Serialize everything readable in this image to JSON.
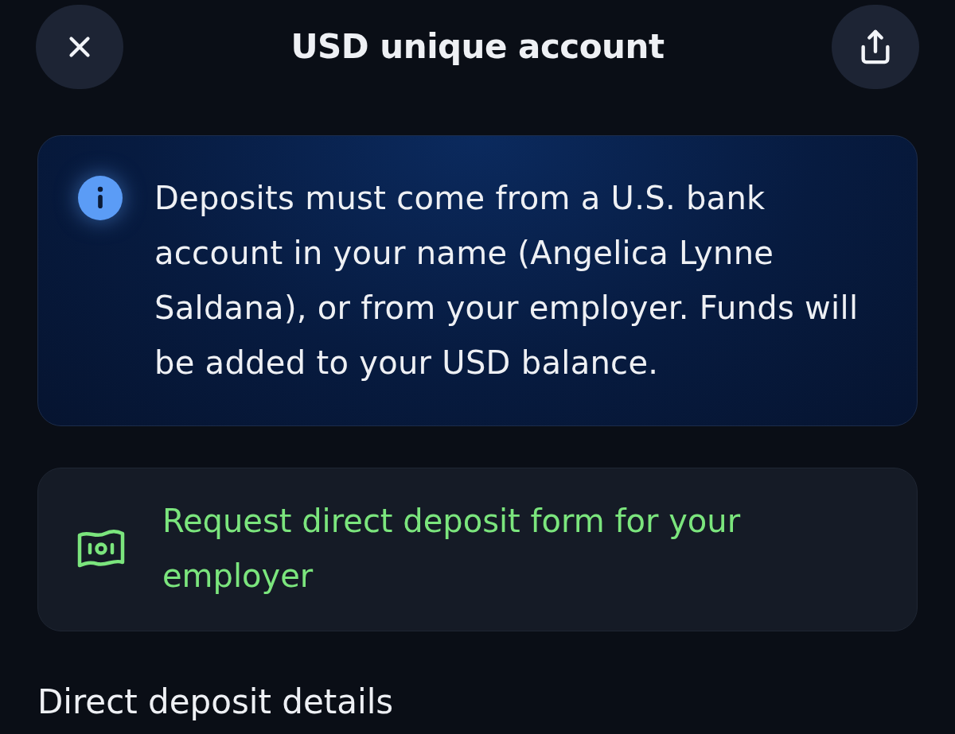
{
  "header": {
    "title": "USD unique account"
  },
  "info_notice": {
    "text": "Deposits must come from a U.S. bank account in your name (Angelica Lynne Saldana), or from your employer. Funds will be added to your USD balance."
  },
  "direct_deposit_form_link": {
    "label": "Request direct deposit form for your employer"
  },
  "section_heading": "Direct deposit details"
}
